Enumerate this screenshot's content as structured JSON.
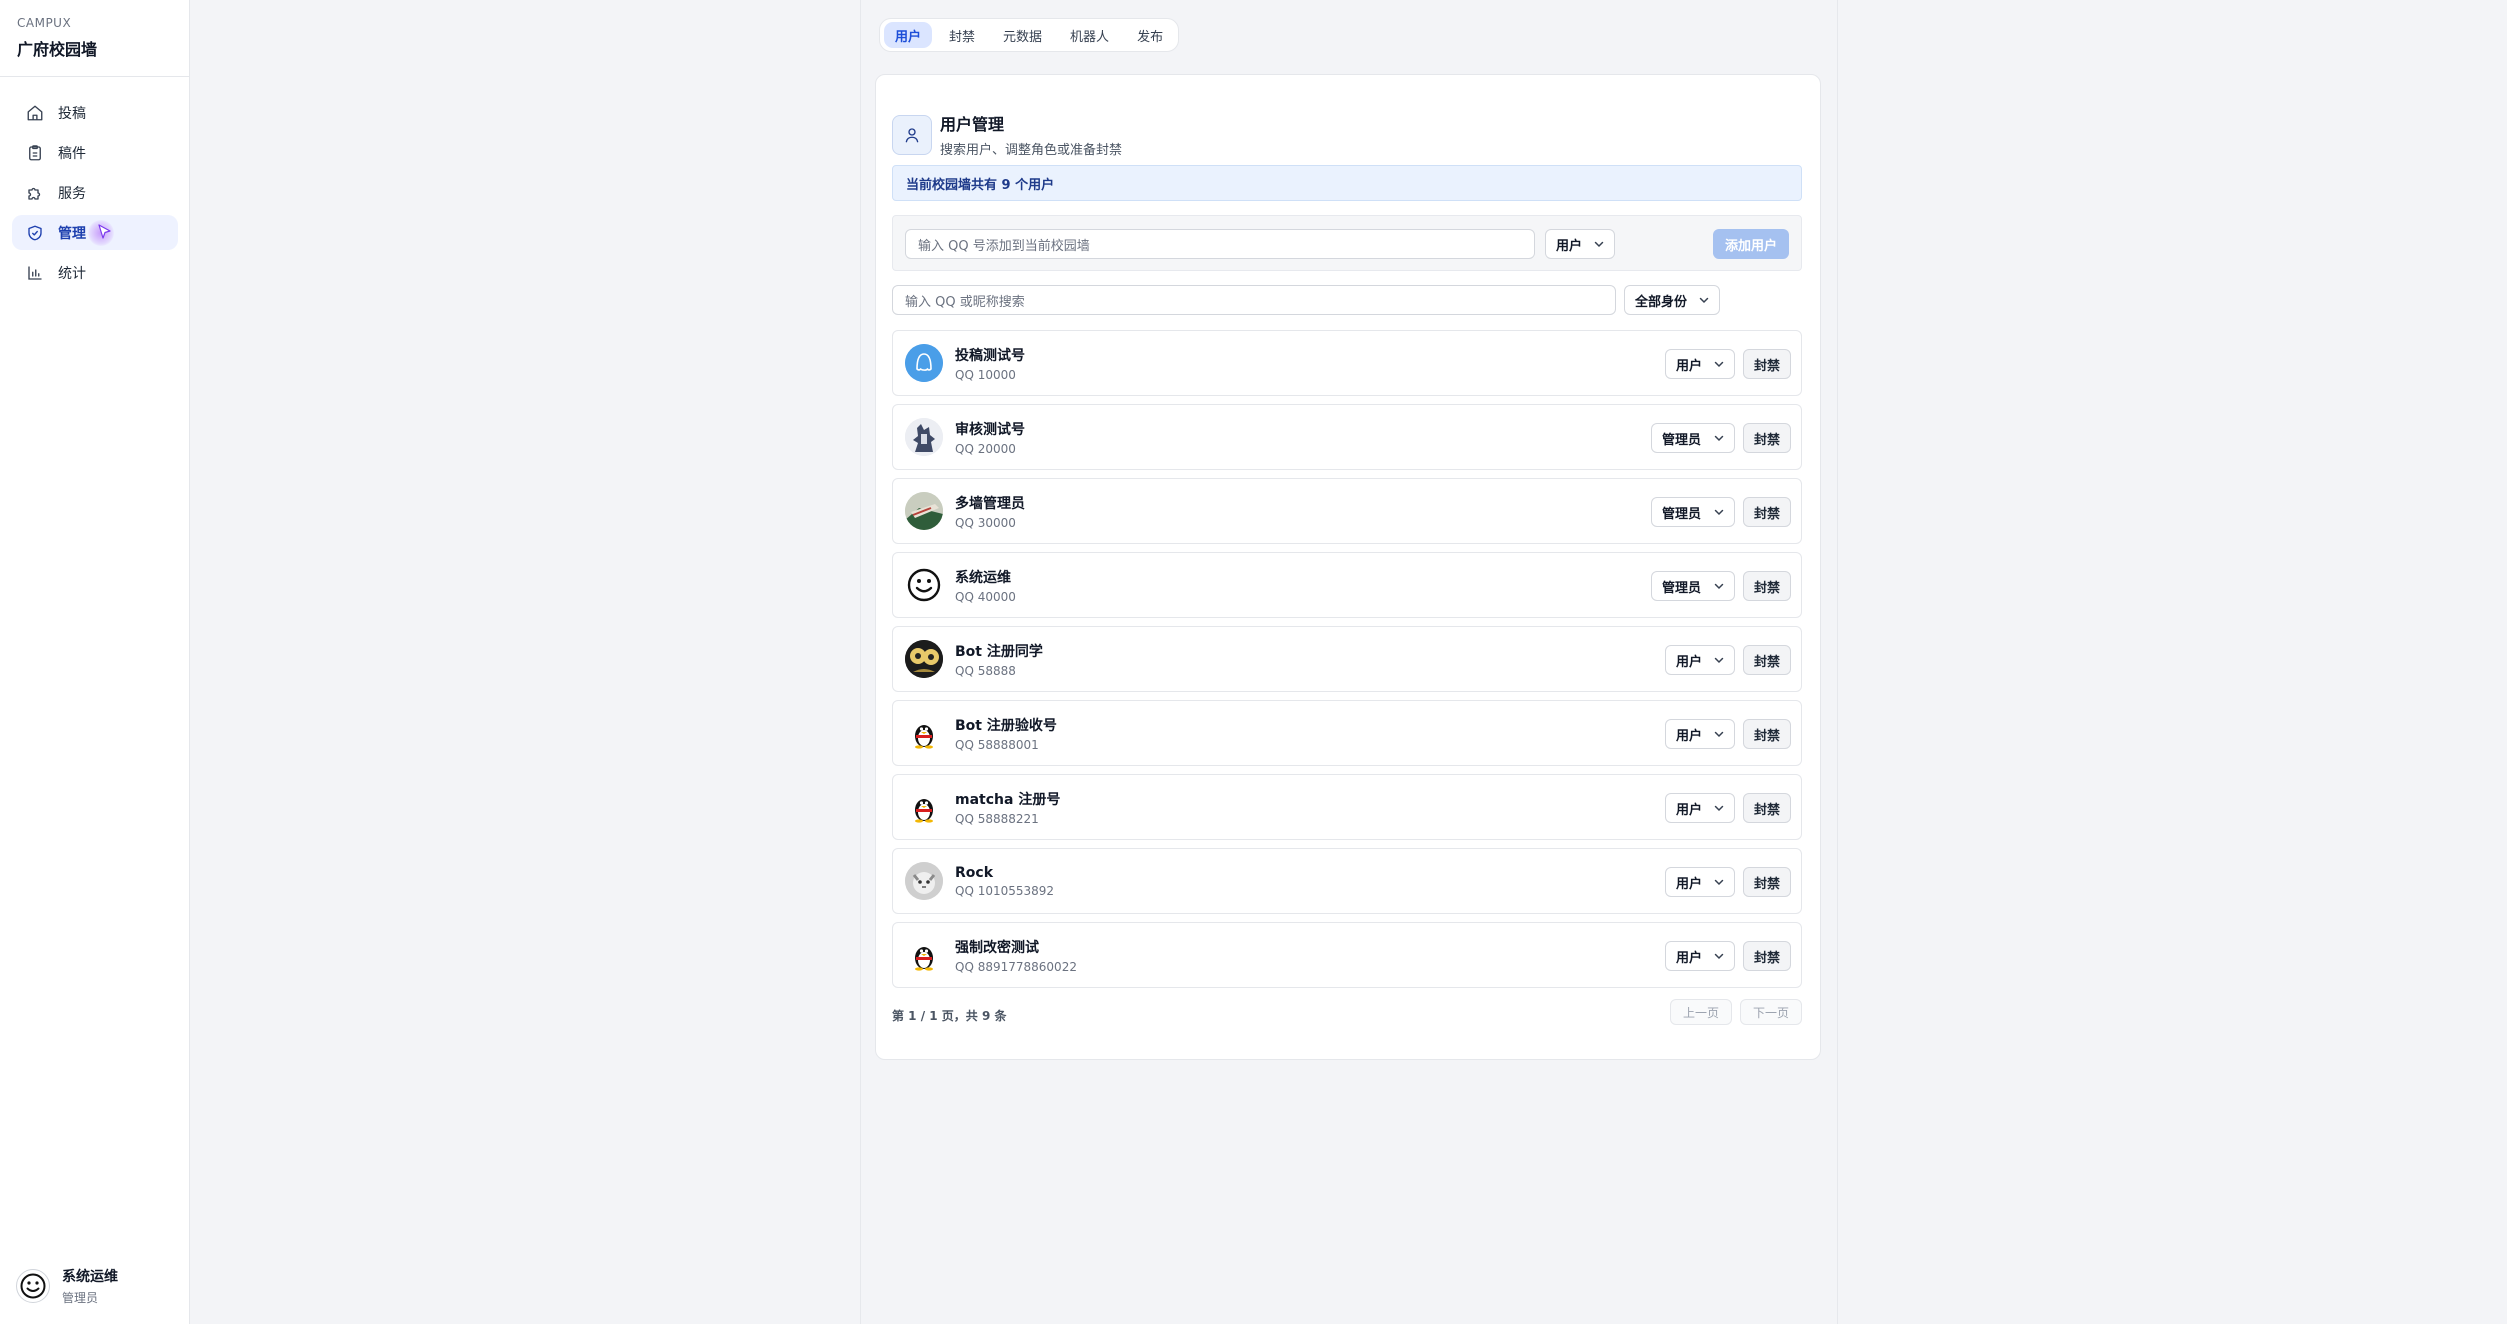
{
  "app": {
    "brand_top": "CAMPUX",
    "brand_name": "广府校园墙"
  },
  "sidebar": {
    "items": [
      {
        "label": "投稿",
        "icon": "home-icon"
      },
      {
        "label": "稿件",
        "icon": "clipboard-icon"
      },
      {
        "label": "服务",
        "icon": "puzzle-icon"
      },
      {
        "label": "管理",
        "icon": "shield-icon",
        "active": true
      },
      {
        "label": "统计",
        "icon": "bar-chart-icon"
      }
    ],
    "current_user": {
      "name": "系统运维",
      "role": "管理员"
    }
  },
  "tabs": [
    "用户",
    "封禁",
    "元数据",
    "机器人",
    "发布"
  ],
  "header": {
    "title": "用户管理",
    "subtitle": "搜索用户、调整角色或准备封禁"
  },
  "info_bar": "当前校园墙共有 9 个用户",
  "add": {
    "placeholder": "输入 QQ 号添加到当前校园墙",
    "role": "用户",
    "button": "添加用户"
  },
  "search": {
    "placeholder": "输入 QQ 或昵称搜索",
    "filter": "全部身份"
  },
  "users": [
    {
      "name": "投稿测试号",
      "qq": "QQ 10000",
      "role": "用户",
      "ban": "封禁"
    },
    {
      "name": "审核测试号",
      "qq": "QQ 20000",
      "role": "管理员",
      "ban": "封禁"
    },
    {
      "name": "多墙管理员",
      "qq": "QQ 30000",
      "role": "管理员",
      "ban": "封禁"
    },
    {
      "name": "系统运维",
      "qq": "QQ 40000",
      "role": "管理员",
      "ban": "封禁"
    },
    {
      "name": "Bot 注册同学",
      "qq": "QQ 58888",
      "role": "用户",
      "ban": "封禁"
    },
    {
      "name": "Bot 注册验收号",
      "qq": "QQ 58888001",
      "role": "用户",
      "ban": "封禁"
    },
    {
      "name": "matcha 注册号",
      "qq": "QQ 58888221",
      "role": "用户",
      "ban": "封禁"
    },
    {
      "name": "Rock",
      "qq": "QQ 1010553892",
      "role": "用户",
      "ban": "封禁"
    },
    {
      "name": "强制改密测试",
      "qq": "QQ 8891778860022",
      "role": "用户",
      "ban": "封禁"
    }
  ],
  "pagination": {
    "summary": "第 1 / 1 页，共 9 条",
    "prev": "上一页",
    "next": "下一页"
  },
  "colors": {
    "accent": "#1d4ed8",
    "tab_active_bg": "#dbe5ff",
    "info_bg": "#eaf2fe",
    "add_button": "#a5c1f0"
  }
}
